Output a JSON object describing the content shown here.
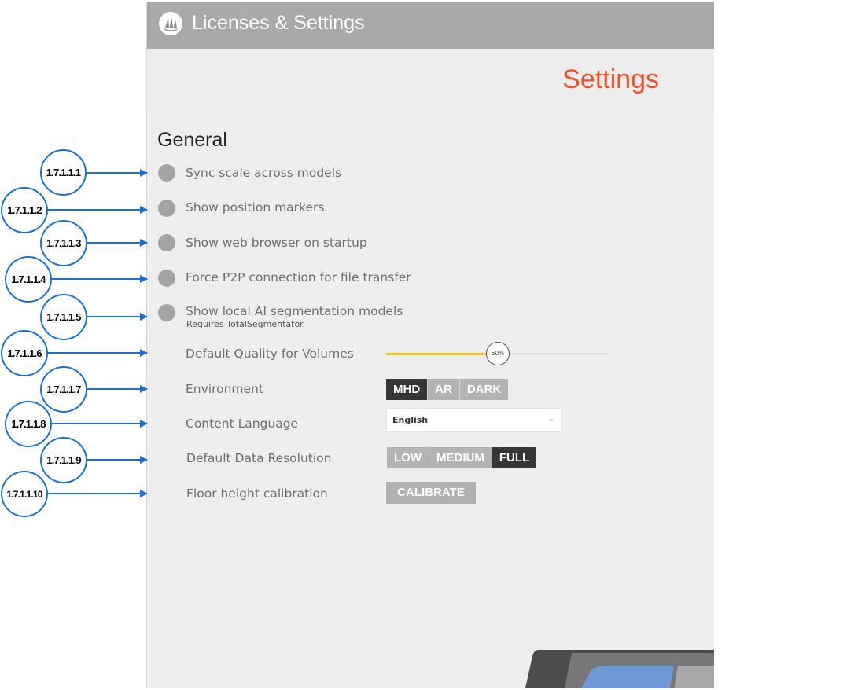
{
  "window": {
    "title": "Licenses & Settings",
    "logo_icon": "sailboat-logo-icon"
  },
  "header": {
    "title": "Settings"
  },
  "general": {
    "section_title": "General",
    "toggles": [
      {
        "label": "Sync scale across models",
        "enabled": false
      },
      {
        "label": "Show position markers",
        "enabled": false
      },
      {
        "label": "Show web browser on startup",
        "enabled": false
      },
      {
        "label": "Force P2P connection for file transfer",
        "enabled": false
      },
      {
        "label": "Show local AI segmentation models",
        "note": "Requires TotalSegmentator.",
        "enabled": false
      }
    ],
    "quality": {
      "label": "Default Quality for Volumes",
      "value": 0.5,
      "value_text": "50%"
    },
    "environment": {
      "label": "Environment",
      "options": [
        "MHD",
        "AR",
        "DARK"
      ],
      "selected": "MHD"
    },
    "language": {
      "label": "Content Language",
      "value": "English"
    },
    "resolution": {
      "label": "Default Data Resolution",
      "options": [
        "LOW",
        "MEDIUM",
        "FULL"
      ],
      "selected": "FULL"
    },
    "calibration": {
      "label": "Floor height calibration",
      "button": "CALIBRATE"
    }
  },
  "annotations": [
    "1.7.1.1.1",
    "1.7.1.1.2",
    "1.7.1.1.3",
    "1.7.1.1.4",
    "1.7.1.1.5",
    "1.7.1.1.6",
    "1.7.1.1.7",
    "1.7.1.1.8",
    "1.7.1.1.9",
    "1.7.1.1.10"
  ],
  "colors": {
    "accent": "#f1512a",
    "slider_fill": "#f5c21b",
    "annotation_blue": "#1d6fd0",
    "titlebar": "#a9a9a9"
  }
}
